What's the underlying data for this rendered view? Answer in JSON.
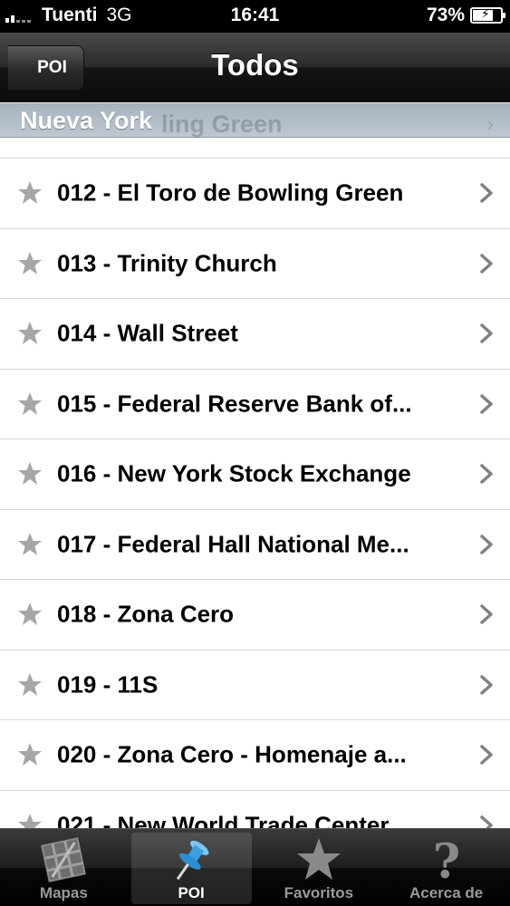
{
  "status_bar": {
    "carrier": "Tuenti",
    "network": "3G",
    "time": "16:41",
    "battery_percent": "73%",
    "battery_level": 0.73
  },
  "nav_bar": {
    "back_label": "POI",
    "title": "Todos"
  },
  "section": {
    "title": "Nueva York",
    "ghost_text": "ling Green"
  },
  "items": [
    {
      "label": "012 - El Toro de Bowling Green"
    },
    {
      "label": "013 - Trinity Church"
    },
    {
      "label": "014 - Wall Street"
    },
    {
      "label": "015 - Federal Reserve Bank of..."
    },
    {
      "label": "016 - New York Stock Exchange"
    },
    {
      "label": "017 - Federal Hall National Me..."
    },
    {
      "label": "018 - Zona Cero"
    },
    {
      "label": "019 - 11S"
    },
    {
      "label": "020 - Zona Cero - Homenaje a..."
    },
    {
      "label": "021 - New World Trade Center"
    }
  ],
  "tab_bar": {
    "tabs": [
      {
        "label": "Mapas",
        "icon": "map-icon"
      },
      {
        "label": "POI",
        "icon": "pushpin-icon"
      },
      {
        "label": "Favoritos",
        "icon": "star-icon"
      },
      {
        "label": "Acerca de",
        "icon": "question-icon"
      }
    ],
    "active_index": 1
  },
  "colors": {
    "star_gray": "#a6a6a6",
    "chevron_gray": "#808080",
    "active_pin": "#3aa0e0"
  }
}
